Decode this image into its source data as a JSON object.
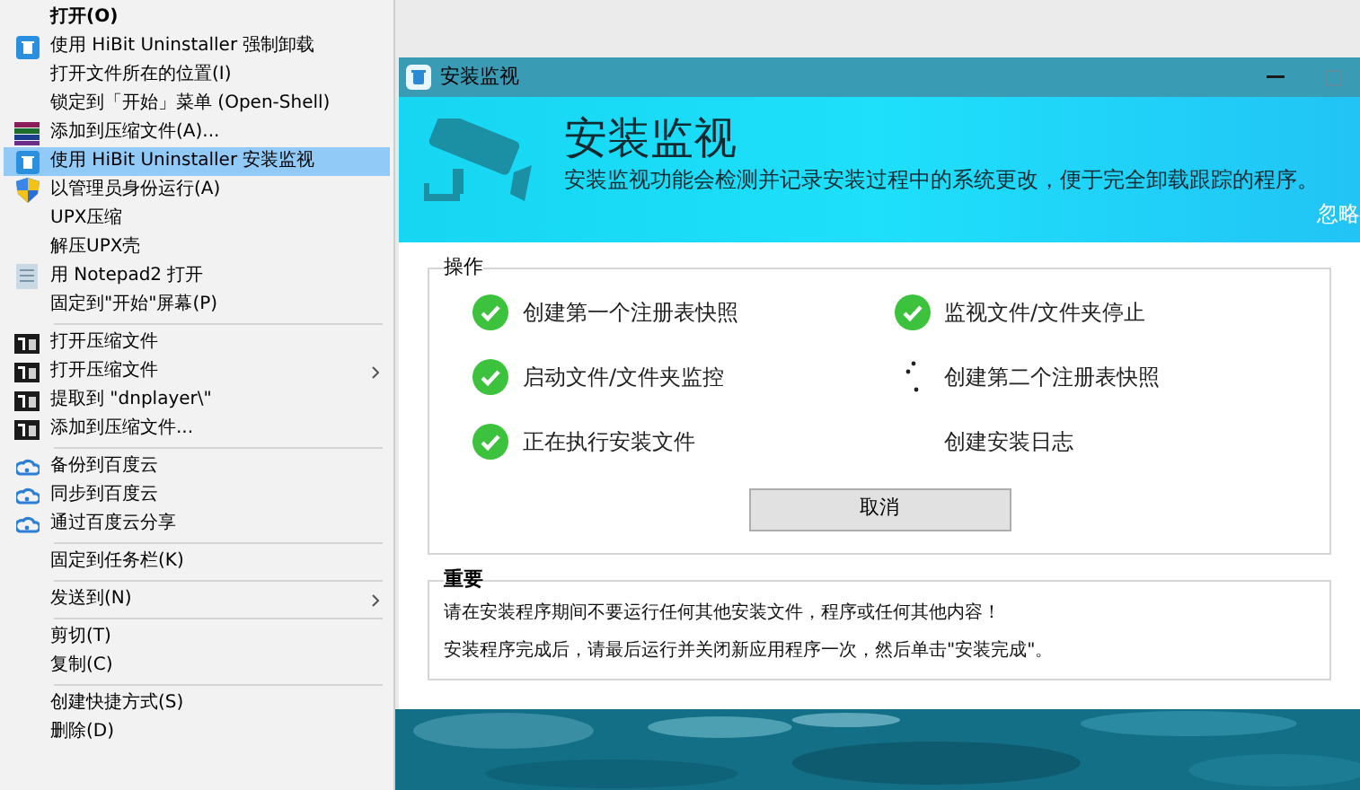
{
  "context_menu": {
    "items": [
      {
        "kind": "default",
        "label": "打开(O)",
        "selected": false,
        "submenu": false
      },
      {
        "kind": "app",
        "label": "使用 HiBit Uninstaller 强制卸载",
        "selected": false,
        "submenu": false
      },
      {
        "kind": "plain",
        "label": "打开文件所在的位置(I)",
        "selected": false,
        "submenu": false
      },
      {
        "kind": "plain",
        "label": "锁定到「开始」菜单 (Open-Shell)",
        "selected": false,
        "submenu": false
      },
      {
        "kind": "books",
        "label": "添加到压缩文件(A)...",
        "selected": false,
        "submenu": false
      },
      {
        "kind": "app",
        "label": "使用 HiBit Uninstaller 安装监视",
        "selected": true,
        "submenu": false
      },
      {
        "kind": "shield",
        "label": "以管理员身份运行(A)",
        "selected": false,
        "submenu": false
      },
      {
        "kind": "plain",
        "label": "UPX压缩",
        "selected": false,
        "submenu": false
      },
      {
        "kind": "plain",
        "label": "解压UPX壳",
        "selected": false,
        "submenu": false
      },
      {
        "kind": "notepad",
        "label": "用 Notepad2 打开",
        "selected": false,
        "submenu": false
      },
      {
        "kind": "plain",
        "label": "固定到\"开始\"屏幕(P)",
        "selected": false,
        "submenu": false
      },
      {
        "kind": "separator"
      },
      {
        "kind": "archive",
        "label": "打开压缩文件",
        "selected": false,
        "submenu": false
      },
      {
        "kind": "archive",
        "label": "打开压缩文件",
        "selected": false,
        "submenu": true
      },
      {
        "kind": "archive",
        "label": "提取到 \"dnplayer\\\"",
        "selected": false,
        "submenu": false
      },
      {
        "kind": "archive",
        "label": "添加到压缩文件...",
        "selected": false,
        "submenu": false
      },
      {
        "kind": "separator"
      },
      {
        "kind": "cloud",
        "label": "备份到百度云",
        "selected": false,
        "submenu": false
      },
      {
        "kind": "cloud",
        "label": "同步到百度云",
        "selected": false,
        "submenu": false
      },
      {
        "kind": "cloud",
        "label": "通过百度云分享",
        "selected": false,
        "submenu": false
      },
      {
        "kind": "separator"
      },
      {
        "kind": "plain",
        "label": "固定到任务栏(K)",
        "selected": false,
        "submenu": false
      },
      {
        "kind": "separator"
      },
      {
        "kind": "plain",
        "label": "发送到(N)",
        "selected": false,
        "submenu": true
      },
      {
        "kind": "separator"
      },
      {
        "kind": "plain",
        "label": "剪切(T)",
        "selected": false,
        "submenu": false
      },
      {
        "kind": "plain",
        "label": "复制(C)",
        "selected": false,
        "submenu": false
      },
      {
        "kind": "separator"
      },
      {
        "kind": "plain",
        "label": "创建快捷方式(S)",
        "selected": false,
        "submenu": false
      },
      {
        "kind": "plain",
        "label": "删除(D)",
        "selected": false,
        "submenu": false
      }
    ]
  },
  "window": {
    "title": "安装监视",
    "banner": {
      "heading": "安装监视",
      "description": "安装监视功能会检测并记录安装过程中的系统更改，便于完全卸载跟踪的程序。",
      "ignore_link": "忽略"
    },
    "operations": {
      "title": "操作",
      "steps": [
        {
          "label": "创建第一个注册表快照",
          "kind": "done"
        },
        {
          "label": "监视文件/文件夹停止",
          "kind": "done"
        },
        {
          "label": "启动文件/文件夹监控",
          "kind": "done"
        },
        {
          "label": "创建第二个注册表快照",
          "kind": "working"
        },
        {
          "label": "正在执行安装文件",
          "kind": "done"
        },
        {
          "label": "创建安装日志",
          "kind": "pending"
        }
      ],
      "cancel_button": "取消"
    },
    "important": {
      "title": "重要",
      "lines": [
        "请在安装程序期间不要运行任何其他安装文件，程序或任何其他内容！",
        "安装程序完成后，请最后运行并关闭新应用程序一次，然后单击\"安装完成\"。"
      ]
    }
  }
}
